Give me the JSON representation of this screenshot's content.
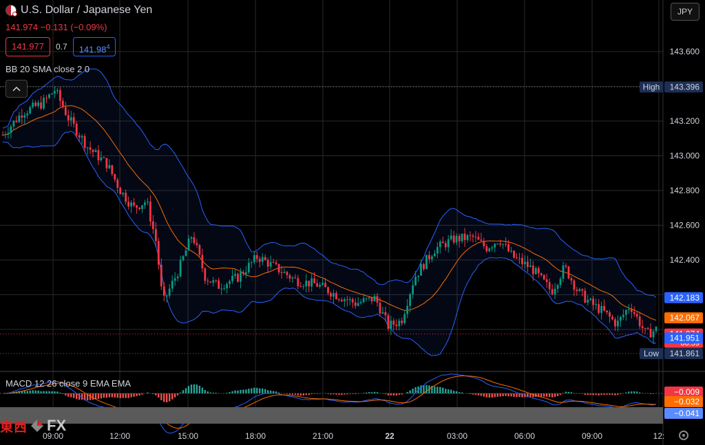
{
  "header": {
    "symbol": "U.S. Dollar / Japanese Yen",
    "flag_icon": "usd-jpy-flag-icon",
    "last_price": "141.974",
    "change": "−0.131",
    "change_pct": "(−0.09%)",
    "bid": "141.977",
    "spread": "0.7",
    "ask_main": "141.98",
    "ask_pip": "4",
    "indicator": "BB 20 SMA close 2 0",
    "currency": "JPY",
    "collapse_icon": "chevron-up-icon"
  },
  "macd_label": "MACD 12 26 close 9 EMA EMA",
  "logo": {
    "jp": "東西",
    "fx": "FX"
  },
  "settings_icon": "gear-icon",
  "colors": {
    "up": "#089981",
    "down": "#f23645",
    "bb": "#2962ff",
    "sma": "#ff6d00",
    "macd_line": "#2962ff",
    "signal_line": "#ff6d00"
  },
  "chart_data": {
    "type": "candlestick",
    "y_axis": {
      "ticks": [
        "143.600",
        "143.200",
        "143.000",
        "142.800",
        "142.600",
        "142.400"
      ],
      "ylim": [
        141.8,
        143.8
      ]
    },
    "x_axis": {
      "ticks": [
        "09:00",
        "12:00",
        "15:00",
        "18:00",
        "21:00",
        "22",
        "03:00",
        "06:00",
        "09:00",
        "12:"
      ]
    },
    "price_labels": [
      {
        "label": "High",
        "value": "143.396",
        "price": 143.396,
        "style": "high"
      },
      {
        "value": "142.183",
        "price": 142.183,
        "style": "bb-upper"
      },
      {
        "value": "142.067",
        "price": 142.067,
        "style": "sma"
      },
      {
        "value": "141.974",
        "sub": "00:59",
        "price": 141.974,
        "style": "last"
      },
      {
        "value": "141.951",
        "price": 141.951,
        "style": "bb-lower"
      },
      {
        "label": "Low",
        "value": "141.861",
        "price": 141.861,
        "style": "low"
      }
    ],
    "price_path": [
      [
        0,
        143.12
      ],
      [
        0.03,
        143.25
      ],
      [
        0.06,
        143.3
      ],
      [
        0.08,
        143.38
      ],
      [
        0.1,
        143.22
      ],
      [
        0.13,
        143.05
      ],
      [
        0.16,
        142.95
      ],
      [
        0.18,
        142.8
      ],
      [
        0.2,
        142.7
      ],
      [
        0.22,
        142.74
      ],
      [
        0.235,
        142.5
      ],
      [
        0.245,
        142.15
      ],
      [
        0.27,
        142.35
      ],
      [
        0.29,
        142.55
      ],
      [
        0.31,
        142.3
      ],
      [
        0.33,
        142.25
      ],
      [
        0.36,
        142.3
      ],
      [
        0.39,
        142.42
      ],
      [
        0.42,
        142.35
      ],
      [
        0.45,
        142.28
      ],
      [
        0.48,
        142.26
      ],
      [
        0.51,
        142.2
      ],
      [
        0.54,
        142.15
      ],
      [
        0.57,
        142.18
      ],
      [
        0.59,
        142.02
      ],
      [
        0.61,
        142.05
      ],
      [
        0.63,
        142.3
      ],
      [
        0.66,
        142.46
      ],
      [
        0.69,
        142.52
      ],
      [
        0.72,
        142.53
      ],
      [
        0.74,
        142.47
      ],
      [
        0.76,
        142.52
      ],
      [
        0.78,
        142.42
      ],
      [
        0.81,
        142.35
      ],
      [
        0.84,
        142.22
      ],
      [
        0.86,
        142.36
      ],
      [
        0.88,
        142.22
      ],
      [
        0.9,
        142.15
      ],
      [
        0.92,
        142.1
      ],
      [
        0.94,
        142.03
      ],
      [
        0.96,
        142.14
      ],
      [
        0.985,
        141.97
      ],
      [
        1.0,
        142.0
      ]
    ],
    "macd": {
      "values": [
        "−0.009",
        "−0.032",
        "−0.041"
      ],
      "styles": [
        "hist",
        "signal",
        "macd"
      ]
    }
  }
}
